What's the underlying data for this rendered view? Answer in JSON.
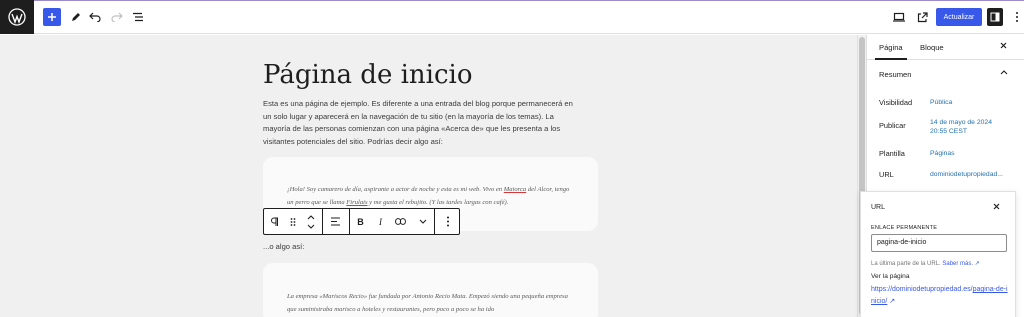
{
  "toolbar": {
    "update_label": "Actualizar",
    "icons": [
      "wordpress-logo",
      "plus",
      "pencil",
      "undo",
      "redo",
      "list-view",
      "desktop-preview",
      "external-link",
      "sidebar-toggle",
      "more-vertical"
    ]
  },
  "colors": {
    "accent": "#3858e9",
    "link": "#2271b1",
    "dark": "#1e1e1e",
    "canvas": "#f0f0f0"
  },
  "editor": {
    "title": "Página de inicio",
    "intro": "Esta es una página de ejemplo. Es diferente a una entrada del blog porque permanecerá en un solo lugar y aparecerá en la navegación de tu sitio (en la mayoría de los temas). La mayoría de las personas comienzan con una página «Acerca de» que les presenta a los visitantes potenciales del sitio. Podrías decir algo así:",
    "quote1_a": "¡Hola! Soy camarero de día, aspirante a actor de noche y esta es mi web. Vivo en ",
    "quote1_city": "Maiorca",
    "quote1_b": " del Alcor, tengo un perro que se llama ",
    "quote1_dog": "Firulais",
    "quote1_c": " y me gusta el rebujito. (Y las tardes largas con café).",
    "o_algo": "...o algo así:",
    "quote2": "La empresa «Mariscos Recio» fue fundada por Antonio Recio Mata. Empezó siendo una pequeña empresa que suministraba marisco a hoteles y restaurantes, pero poco a poco se ha ido"
  },
  "block_toolbar": {
    "icons": [
      "paragraph",
      "drag-handle",
      "move-up-down",
      "align-left",
      "bold",
      "italic",
      "link",
      "chevron-down",
      "more-options"
    ]
  },
  "sidebar": {
    "tab_page": "Página",
    "tab_block": "Bloque",
    "summary": "Resumen",
    "visibility_label": "Visibilidad",
    "visibility_value": "Pública",
    "publish_label": "Publicar",
    "publish_value_1": "14 de mayo de 2024",
    "publish_value_2": "20:55 CEST",
    "template_label": "Plantilla",
    "template_value": "Páginas",
    "url_label": "URL",
    "url_value": "dominiodetupropiedad..."
  },
  "url_popover": {
    "title": "URL",
    "permalink_label": "ENLACE PERMANENTE",
    "permalink_value": "pagina-de-inicio",
    "help_text": "La última parte de la URL.",
    "help_link": "Saber más.",
    "view_page": "Ver la página",
    "link_prefix": "https://dominiodetupropiedad.es/",
    "link_slug": "pagina-de-inicio/"
  }
}
